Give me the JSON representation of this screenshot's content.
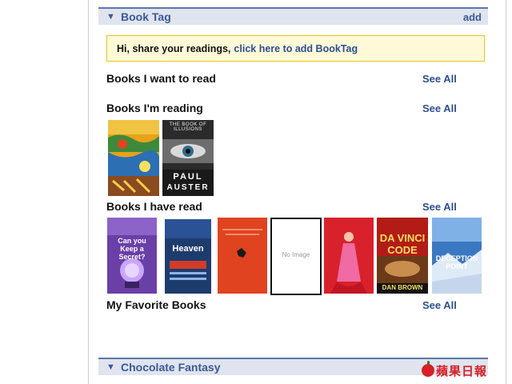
{
  "book_tag": {
    "title": "Book Tag",
    "add_label": "add"
  },
  "notice": {
    "prefix": "Hi, share your readings,",
    "link": "click here to add BookTag"
  },
  "shelves": {
    "want": {
      "label": "Books I want to read",
      "see_all": "See All"
    },
    "reading": {
      "label": "Books I'm reading",
      "see_all": "See All"
    },
    "read": {
      "label": "Books I have read",
      "see_all": "See All"
    },
    "favorite": {
      "label": "My Favorite Books",
      "see_all": "See All"
    }
  },
  "reading_books": [
    {
      "name": "colorful-illustrated-cover",
      "bg": "#e8a21a"
    },
    {
      "name": "the-book-of-illusions",
      "top_text": "THE BOOK OF ILLUSIONS",
      "author_first": "PAUL",
      "author_last": "AUSTER",
      "bg": "#2b2b2b"
    }
  ],
  "read_books": [
    {
      "name": "can-you-keep-a-secret",
      "cover_text": "Can you Keep a Secret?",
      "bg": "#6a3fa8"
    },
    {
      "name": "five-people-you-meet-in-heaven",
      "cover_text": "Heaven",
      "bg": "#1d3c6e"
    },
    {
      "name": "red-cover",
      "bg": "#e0431f"
    },
    {
      "name": "no-image",
      "cover_text": "No Image",
      "bg": "#ffffff"
    },
    {
      "name": "pink-dress-cover",
      "bg": "#d8212b"
    },
    {
      "name": "the-da-vinci-code",
      "title_1": "DA VINCI",
      "title_2": "CODE",
      "author": "DAN BROWN",
      "bg": "#b31b17"
    },
    {
      "name": "deception-point",
      "cover_text": "DECEPTION POINT",
      "bg": "#3b78c2"
    }
  ],
  "next_section": {
    "title": "Chocolate Fantasy"
  },
  "brand": {
    "text": "蘋果日報"
  }
}
